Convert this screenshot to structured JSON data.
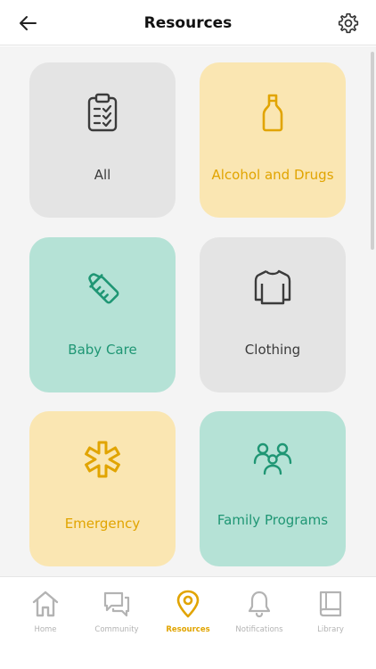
{
  "header": {
    "title": "Resources",
    "back_icon": "arrow-left-icon",
    "settings_icon": "gear-icon"
  },
  "tiles": [
    {
      "label": "All",
      "icon": "clipboard-checklist-icon",
      "color": "gray"
    },
    {
      "label": "Alcohol and Drugs",
      "icon": "bottle-icon",
      "color": "yellow"
    },
    {
      "label": "Baby Care",
      "icon": "baby-bottle-icon",
      "color": "green"
    },
    {
      "label": "Clothing",
      "icon": "shirt-icon",
      "color": "gray"
    },
    {
      "label": "Emergency",
      "icon": "medical-star-icon",
      "color": "yellow"
    },
    {
      "label": "Family Programs",
      "icon": "family-icon",
      "color": "green"
    }
  ],
  "tabs": [
    {
      "label": "Home",
      "icon": "home-icon",
      "active": false
    },
    {
      "label": "Community",
      "icon": "chat-icon",
      "active": false
    },
    {
      "label": "Resources",
      "icon": "map-pin-icon",
      "active": true
    },
    {
      "label": "Notifications",
      "icon": "bell-icon",
      "active": false
    },
    {
      "label": "Library",
      "icon": "book-icon",
      "active": false
    }
  ],
  "colors": {
    "yellow_accent": "#e1a400",
    "green_accent": "#1f9674",
    "gray_text": "#3b3b3b",
    "yellow_bg": "#fae6b2",
    "green_bg": "#b5e2d6",
    "gray_bg": "#e4e4e4"
  }
}
